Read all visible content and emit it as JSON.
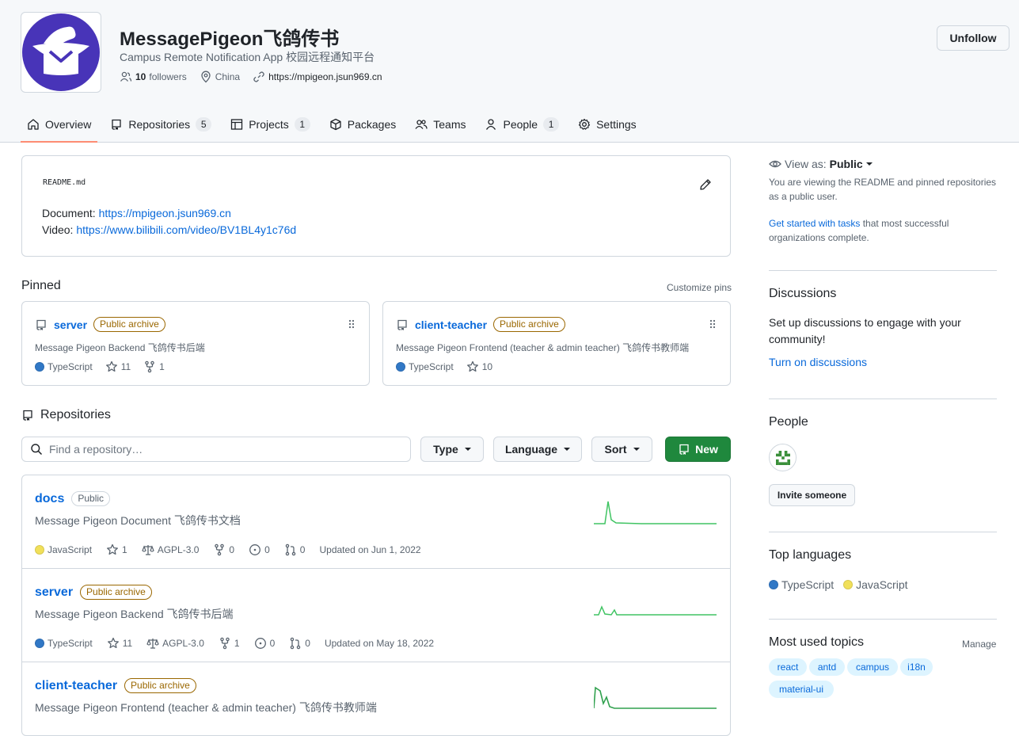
{
  "header": {
    "org_name": "MessagePigeon飞鸽传书",
    "org_description": "Campus Remote Notification App 校园远程通知平台",
    "followers_count": "10",
    "followers_label": "followers",
    "location": "China",
    "website": "https://mpigeon.jsun969.cn",
    "unfollow_label": "Unfollow"
  },
  "tabs": [
    {
      "label": "Overview",
      "icon": "home-icon"
    },
    {
      "label": "Repositories",
      "count": "5",
      "icon": "repo-icon"
    },
    {
      "label": "Projects",
      "count": "1",
      "icon": "table-icon"
    },
    {
      "label": "Packages",
      "icon": "package-icon"
    },
    {
      "label": "Teams",
      "icon": "people-icon"
    },
    {
      "label": "People",
      "count": "1",
      "icon": "person-icon"
    },
    {
      "label": "Settings",
      "icon": "gear-icon"
    }
  ],
  "readme": {
    "filename": "README.md",
    "doc_label": "Document:",
    "doc_link": "https://mpigeon.jsun969.cn",
    "video_label": "Video:",
    "video_link": "https://www.bilibili.com/video/BV1BL4y1c76d"
  },
  "pinned": {
    "title": "Pinned",
    "customize_label": "Customize pins",
    "items": [
      {
        "name": "server",
        "badge": "Public archive",
        "description": "Message Pigeon Backend 飞鸽传书后端",
        "language": "TypeScript",
        "language_color": "#3178c6",
        "stars": "11",
        "forks": "1"
      },
      {
        "name": "client-teacher",
        "badge": "Public archive",
        "description": "Message Pigeon Frontend (teacher & admin teacher) 飞鸽传书教师端",
        "language": "TypeScript",
        "language_color": "#3178c6",
        "stars": "10"
      }
    ]
  },
  "repositories": {
    "title": "Repositories",
    "search_placeholder": "Find a repository…",
    "type_label": "Type",
    "language_label": "Language",
    "sort_label": "Sort",
    "new_label": "New",
    "items": [
      {
        "name": "docs",
        "badge": "Public",
        "description": "Message Pigeon Document 飞鸽传书文档",
        "language": "JavaScript",
        "language_color": "#f1e05a",
        "stars": "1",
        "license": "AGPL-3.0",
        "forks": "0",
        "issues": "0",
        "prs": "0",
        "updated": "Updated on Jun 1, 2022"
      },
      {
        "name": "server",
        "badge": "Public archive",
        "description": "Message Pigeon Backend 飞鸽传书后端",
        "language": "TypeScript",
        "language_color": "#3178c6",
        "stars": "11",
        "license": "AGPL-3.0",
        "forks": "1",
        "issues": "0",
        "prs": "0",
        "updated": "Updated on May 18, 2022"
      },
      {
        "name": "client-teacher",
        "badge": "Public archive",
        "description": "Message Pigeon Frontend (teacher & admin teacher) 飞鸽传书教师端"
      }
    ]
  },
  "sidebar": {
    "view_as_label": "View as:",
    "view_as_value": "Public",
    "view_as_desc": "You are viewing the README and pinned repositories as a public user.",
    "get_started_link": "Get started with tasks",
    "get_started_rest": " that most successful organizations complete.",
    "discussions_title": "Discussions",
    "discussions_desc": "Set up discussions to engage with your community!",
    "discussions_link": "Turn on discussions",
    "people_title": "People",
    "invite_label": "Invite someone",
    "top_languages_title": "Top languages",
    "languages": [
      {
        "name": "TypeScript",
        "color": "#3178c6"
      },
      {
        "name": "JavaScript",
        "color": "#f1e05a"
      }
    ],
    "topics_title": "Most used topics",
    "manage_label": "Manage",
    "topics": [
      "react",
      "antd",
      "campus",
      "i18n",
      "material-ui"
    ]
  }
}
